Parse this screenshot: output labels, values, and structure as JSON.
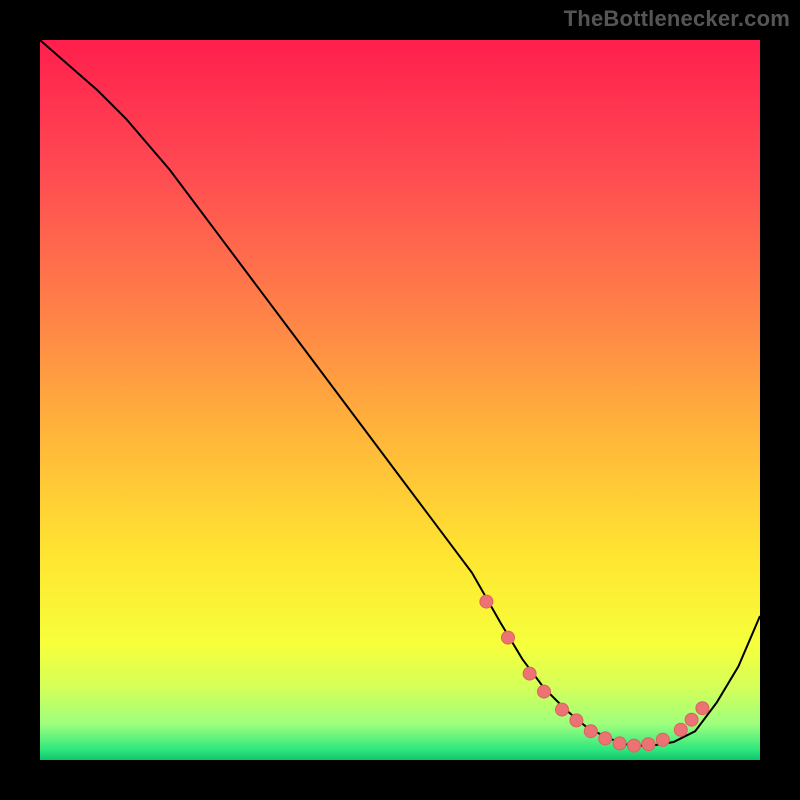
{
  "watermark": "TheBottlenecker.com",
  "colors": {
    "frame_bg": "#000000",
    "curve_stroke": "#000000",
    "marker_fill": "#ec7373",
    "marker_stroke": "#e06060",
    "gradient_stops": [
      {
        "offset": 0.0,
        "color": "#ff1f4d"
      },
      {
        "offset": 0.18,
        "color": "#ff4a52"
      },
      {
        "offset": 0.38,
        "color": "#ff8248"
      },
      {
        "offset": 0.55,
        "color": "#ffb63a"
      },
      {
        "offset": 0.72,
        "color": "#ffe631"
      },
      {
        "offset": 0.84,
        "color": "#f6ff3b"
      },
      {
        "offset": 0.9,
        "color": "#d4ff5a"
      },
      {
        "offset": 0.95,
        "color": "#9eff7d"
      },
      {
        "offset": 0.985,
        "color": "#30e87e"
      },
      {
        "offset": 1.0,
        "color": "#12c46d"
      }
    ]
  },
  "chart_data": {
    "type": "line",
    "title": "",
    "xlabel": "",
    "ylabel": "",
    "xlim": [
      0,
      100
    ],
    "ylim": [
      0,
      100
    ],
    "grid": false,
    "curve": {
      "x": [
        0,
        4,
        8,
        12,
        18,
        24,
        30,
        36,
        42,
        48,
        54,
        60,
        64,
        67,
        70,
        73,
        76,
        79,
        82,
        85,
        88,
        91,
        94,
        97,
        100
      ],
      "y": [
        100,
        96.5,
        93,
        89,
        82,
        74,
        66,
        58,
        50,
        42,
        34,
        26,
        19,
        14,
        10,
        7,
        4.5,
        3,
        2,
        2,
        2.5,
        4,
        8,
        13,
        20
      ]
    },
    "markers": {
      "x": [
        62,
        65,
        68,
        70,
        72.5,
        74.5,
        76.5,
        78.5,
        80.5,
        82.5,
        84.5,
        86.5,
        89,
        90.5,
        92
      ],
      "y": [
        22,
        17,
        12,
        9.5,
        7,
        5.5,
        4,
        3,
        2.3,
        2,
        2.2,
        2.8,
        4.2,
        5.6,
        7.2
      ]
    }
  }
}
